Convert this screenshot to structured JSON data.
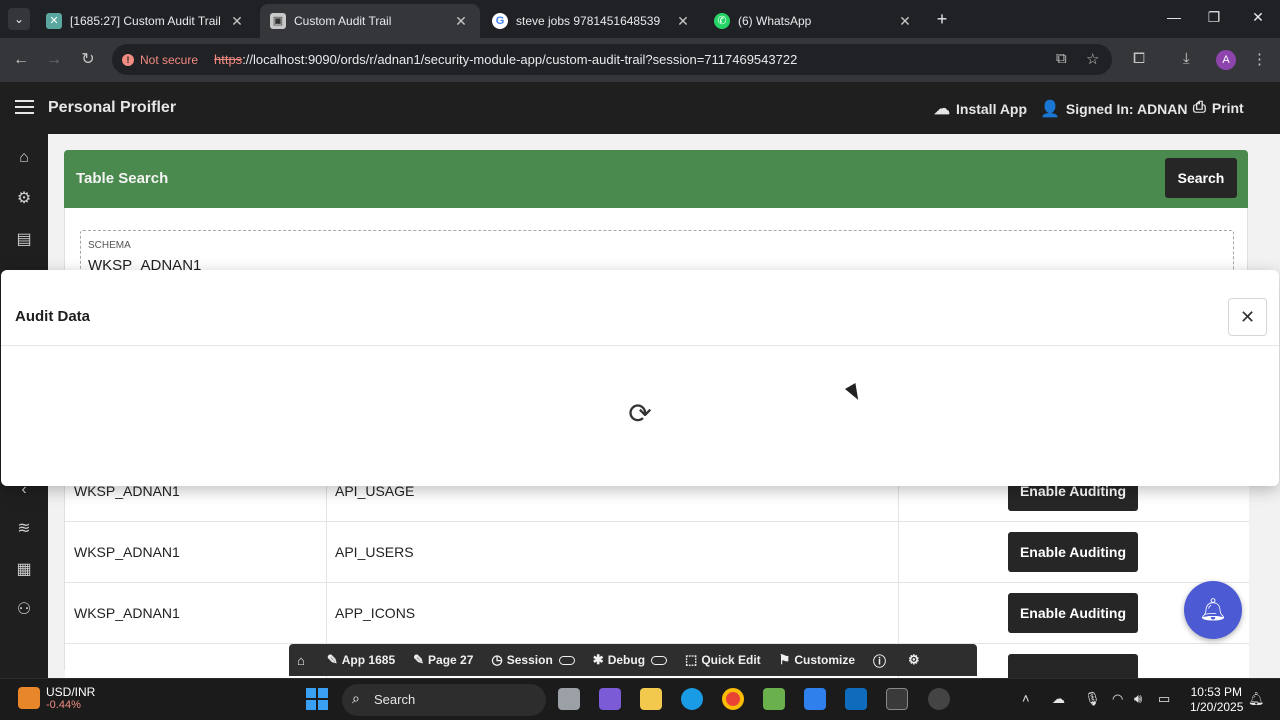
{
  "browser": {
    "tabs": [
      {
        "title": "[1685:27] Custom Audit Trail",
        "active": false,
        "favicon": "apex-builder-icon"
      },
      {
        "title": "Custom Audit Trail",
        "active": true,
        "favicon": "apex-app-icon"
      },
      {
        "title": "steve jobs 9781451648539",
        "active": false,
        "favicon": "google-icon"
      },
      {
        "title": "(6) WhatsApp",
        "active": false,
        "favicon": "whatsapp-icon"
      }
    ],
    "security_label": "Not secure",
    "url_scheme": "https",
    "url_rest": "://localhost:9090/ords/r/adnan1/security-module-app/custom-audit-trail?session=7117469543722",
    "profile_initial": "A"
  },
  "app": {
    "title": "Personal Proifler",
    "header_actions": {
      "install": "Install App",
      "signed_in": "Signed In: ADNAN",
      "print": "Print"
    },
    "search_region": {
      "title": "Table Search",
      "search_button": "Search",
      "schema_label": "SCHEMA",
      "schema_value": "WKSP_ADNAN1"
    },
    "rows": [
      {
        "schema": "WKSP_ADNAN1",
        "table": "API_USAGE",
        "action": "Enable Auditing"
      },
      {
        "schema": "WKSP_ADNAN1",
        "table": "API_USERS",
        "action": "Enable Auditing"
      },
      {
        "schema": "WKSP_ADNAN1",
        "table": "APP_ICONS",
        "action": "Enable Auditing"
      }
    ],
    "dev_toolbar": {
      "app": "App 1685",
      "page": "Page 27",
      "session": "Session",
      "debug": "Debug",
      "quick_edit": "Quick Edit",
      "customize": "Customize"
    }
  },
  "modal": {
    "title": "Audit Data"
  },
  "taskbar": {
    "ticker_name": "USD/INR",
    "ticker_change": "-0.44%",
    "search_placeholder": "Search",
    "time": "10:53 PM",
    "date": "1/20/2025"
  },
  "colors": {
    "search_region": "#4b8a4e",
    "notify_button": "#4c5bd4",
    "not_secure": "#f28b82"
  }
}
